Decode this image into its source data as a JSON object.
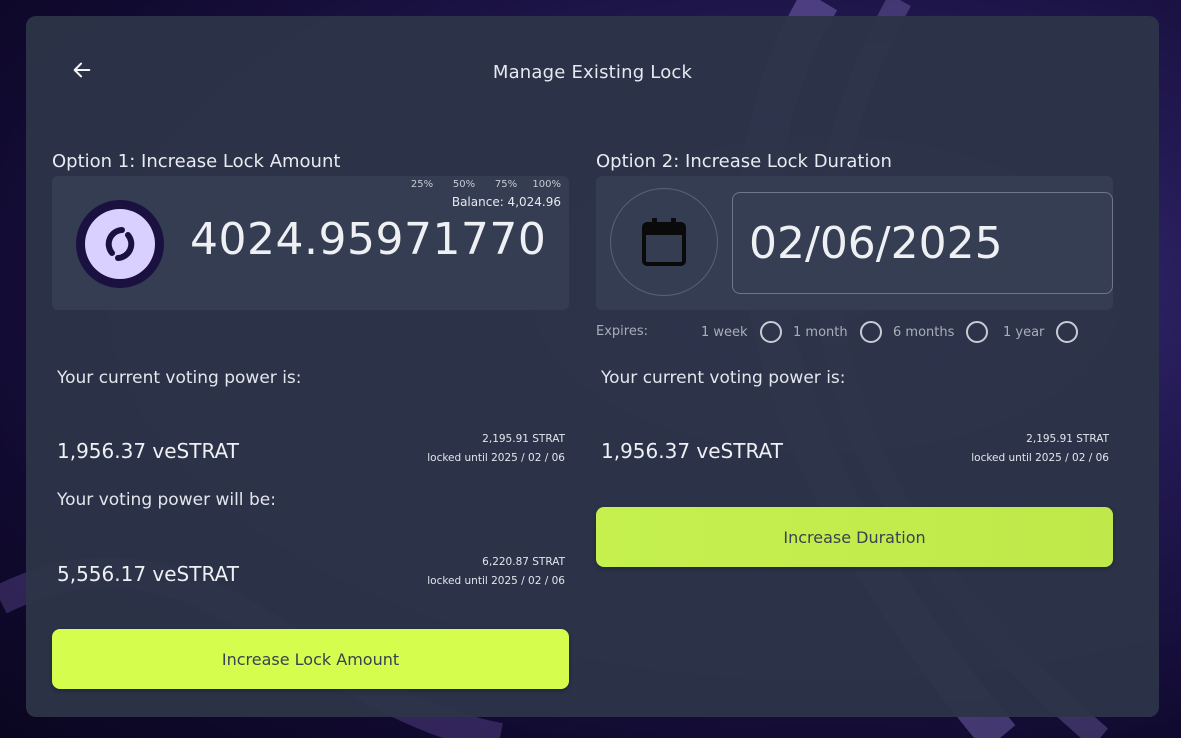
{
  "header": {
    "title": "Manage Existing Lock"
  },
  "option1": {
    "title": "Option 1: Increase Lock Amount",
    "percent_buttons": [
      "25%",
      "50%",
      "75%",
      "100%"
    ],
    "balance": "Balance: 4,024.96",
    "amount": "4024.95971770",
    "current_label": "Your current voting power is:",
    "current_value": "1,956.37 veSTRAT",
    "current_locked_amount": "2,195.91 STRAT",
    "current_locked_until": "locked until 2025 / 02 / 06",
    "future_label": "Your voting power will be:",
    "future_value": "5,556.17 veSTRAT",
    "future_locked_amount": "6,220.87 STRAT",
    "future_locked_until": "locked until 2025 / 02 / 06",
    "button_label": "Increase Lock Amount"
  },
  "option2": {
    "title": "Option 2: Increase Lock Duration",
    "date": "02/06/2025",
    "expires_label": "Expires:",
    "expires_options": [
      "1 week",
      "1 month",
      "6 months",
      "1 year"
    ],
    "current_label": "Your current voting power is:",
    "current_value": "1,956.37 veSTRAT",
    "current_locked_amount": "2,195.91 STRAT",
    "current_locked_until": "locked until 2025 / 02 / 06",
    "button_label": "Increase Duration"
  },
  "colors": {
    "panel": "#2d3448",
    "accent_lime": "#d4fd4e",
    "accent_green": "#c5f04e"
  },
  "icons": {
    "back": "arrow-left-icon",
    "token": "strat-token-icon",
    "calendar": "calendar-icon"
  }
}
